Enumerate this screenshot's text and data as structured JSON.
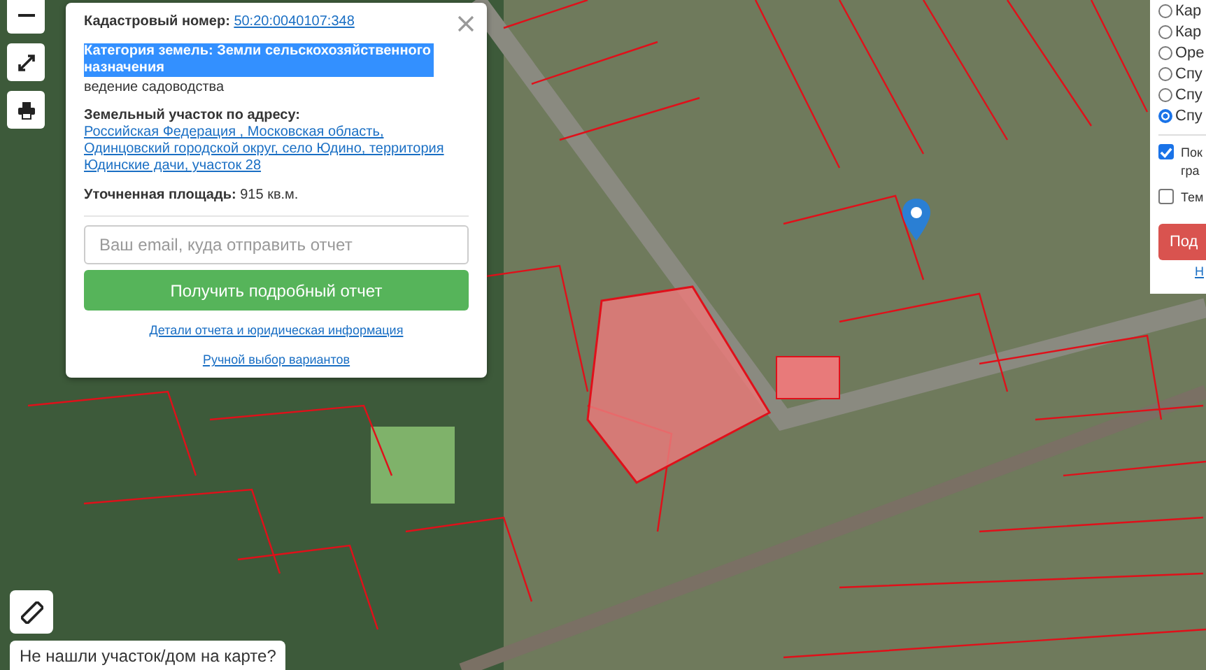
{
  "popup": {
    "cadastral_label": "Кадастровый номер:",
    "cadastral_number": "50:20:0040107:348",
    "category": "Категория земель: Земли сельскохозяйственного назначения",
    "category_selected": true,
    "usage": "ведение садоводства",
    "address_label": "Земельный участок по адресу:",
    "address": "Российская Федерация , Московская область, Одинцовский городской округ, село Юдино, территория Юдинские дачи, участок 28",
    "area_label": "Уточненная площадь:",
    "area": "915 кв.м.",
    "email_placeholder": "Ваш email, куда отправить отчет",
    "submit": "Получить подробный отчет",
    "details_link": "Детали отчета и юридическая информация",
    "manual_link": "Ручной выбор вариантов"
  },
  "layers": {
    "radios": [
      {
        "label": "Кар",
        "selected": false
      },
      {
        "label": "Кар",
        "selected": false
      },
      {
        "label": "Оре",
        "selected": false
      },
      {
        "label": "Спу",
        "selected": false
      },
      {
        "label": "Спу",
        "selected": false
      },
      {
        "label": "Спу",
        "selected": true
      }
    ],
    "checkboxes": [
      {
        "label": "Пок гра",
        "checked": true
      },
      {
        "label": "Тем",
        "checked": false
      }
    ],
    "button": "Под",
    "link": "Н"
  },
  "not_found": "Не нашли участок/дом на карте?"
}
